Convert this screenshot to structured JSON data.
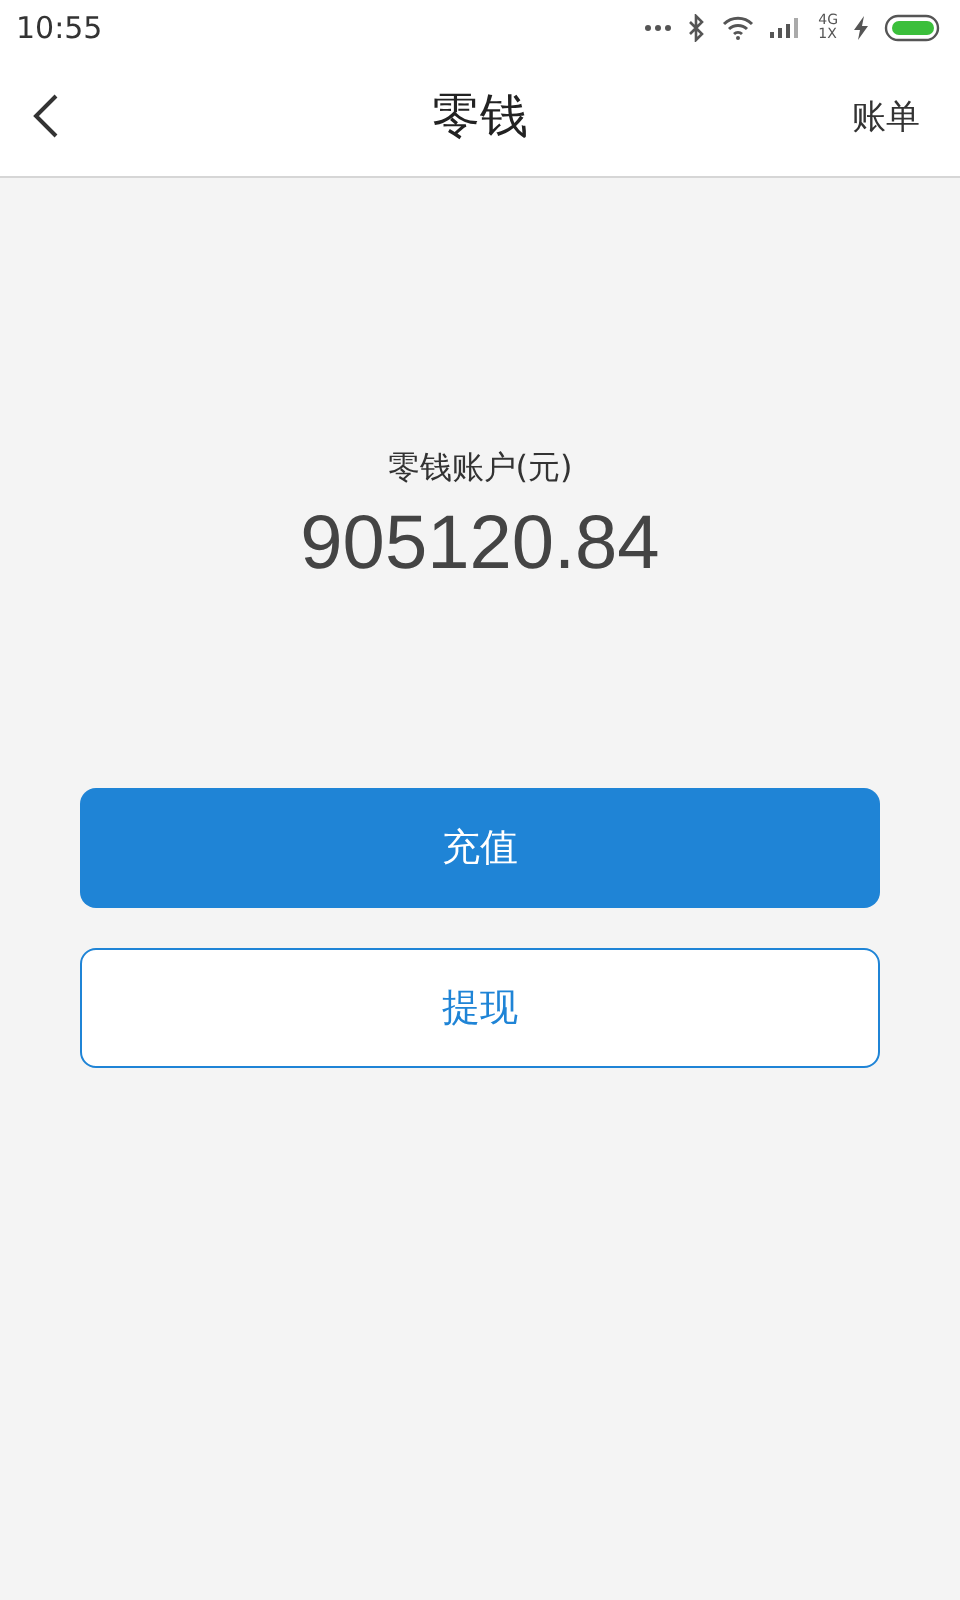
{
  "status_bar": {
    "time": "10:55",
    "network_top": "4G",
    "network_bottom": "1X",
    "charging": true
  },
  "header": {
    "title": "零钱",
    "action": "账单"
  },
  "balance": {
    "label": "零钱账户(元)",
    "amount": "905120.84"
  },
  "buttons": [
    {
      "label": "充值",
      "kind": "primary"
    },
    {
      "label": "提现",
      "kind": "outline"
    }
  ]
}
